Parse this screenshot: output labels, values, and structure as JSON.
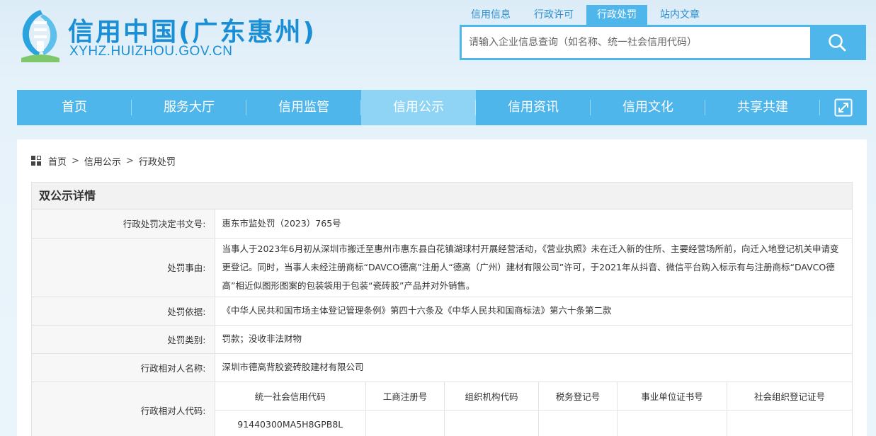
{
  "header": {
    "site_title": "信用中国(广东惠州)",
    "site_domain": "XYHZ.HUIZHOU.GOV.CN",
    "logo_icon": "huizhou-credit-logo",
    "accent_color": "#4fb6ec"
  },
  "search": {
    "tabs": [
      "信用信息",
      "行政许可",
      "行政处罚",
      "站内文章"
    ],
    "active_tab": "行政处罚",
    "placeholder": "请输入企业信息查询（如名称、统一社会信用代码）",
    "button_icon": "search-icon"
  },
  "nav": {
    "items": [
      "首页",
      "服务大厅",
      "信用监管",
      "信用公示",
      "信用资讯",
      "信用文化",
      "共享共建"
    ],
    "active": "信用公示",
    "expand_icon": "expand-icon"
  },
  "breadcrumb": {
    "icon": "grid-icon",
    "items": [
      "首页",
      "信用公示",
      "行政处罚"
    ],
    "separator": ">"
  },
  "detail": {
    "title": "双公示详情",
    "rows": [
      {
        "label": "行政处罚决定书文号:",
        "value": "惠东市监处罚（2023）765号"
      },
      {
        "label": "处罚事由:",
        "value": "当事人于2023年6月初从深圳市搬迁至惠州市惠东县白花镇湖球村开展经营活动，《营业执照》未在迁入新的住所、主要经营场所前，向迁入地登记机关申请变更登记。同时，当事人未经注册商标“DAVCO德高”注册人“德高（广州）建材有限公司”许可，于2021年从抖音、微信平台购入标示有与注册商标“DAVCO德高”相近似图形图案的包装袋用于包装“瓷砖胶”产品并对外销售。"
      },
      {
        "label": "处罚依据:",
        "value": "《中华人民共和国市场主体登记管理条例》第四十六条及《中华人民共和国商标法》第六十条第二款"
      },
      {
        "label": "处罚类别:",
        "value": "罚款；没收非法财物"
      },
      {
        "label": "行政相对人名称:",
        "value": "深圳市德高背胶瓷砖胶建材有限公司"
      }
    ],
    "code_row": {
      "label": "行政相对人代码:",
      "columns": [
        "统一社会信用代码",
        "工商注册号",
        "组织机构代码",
        "税务登记号",
        "事业单位证书号",
        "社会组织登记证号"
      ],
      "values": [
        "91440300MA5H8GPB8L",
        "",
        "",
        "",
        "",
        ""
      ]
    }
  }
}
